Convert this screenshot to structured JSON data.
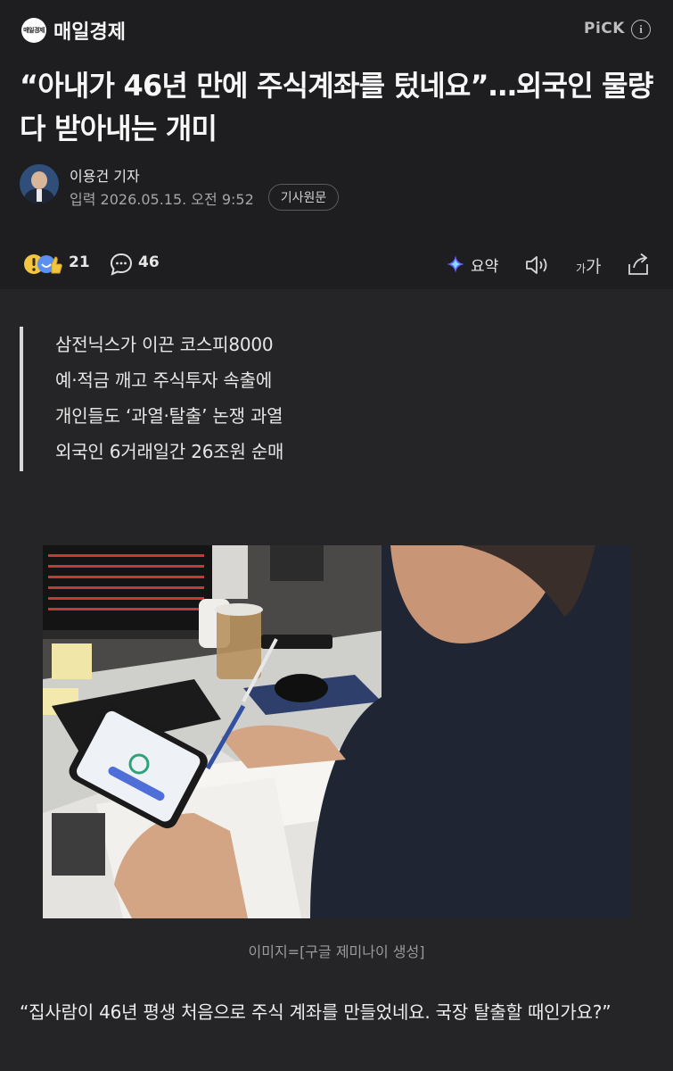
{
  "press": {
    "logo_text": "매일경제",
    "name": "매일경제"
  },
  "header": {
    "pick_label": "PiCK",
    "info_icon": "i"
  },
  "article": {
    "headline": "“아내가 46년 만에 주식계좌를 텄네요”…외국인 물량 다 받아내는 개미",
    "author": "이용건 기자",
    "date": "입력 2026.05.15. 오전 9:52",
    "original_button": "기사원문"
  },
  "actions": {
    "reaction_count": "21",
    "comment_count": "46",
    "summary_label": "요약",
    "font_small": "가",
    "font_big": "가"
  },
  "summary": [
    "삼전닉스가 이끈 코스피8000",
    "예·적금 깨고 주식투자 속출에",
    "개인들도 ‘과열·탈출’ 논쟁 과열",
    "외국인 6거래일간 26조원 순매"
  ],
  "photo": {
    "caption": "이미지=[구글 제미나이 생성]"
  },
  "body": {
    "quote": "“집사람이 46년 평생 처음으로 주식 계좌를 만들었네요. 국장 탈출할 때인가요?”"
  },
  "colors": {
    "background": "#1e1e20",
    "body_background": "#252527",
    "text": "#f2f2f2",
    "muted": "#a6a6a6",
    "sparkle_accent": "#6a5cff"
  }
}
